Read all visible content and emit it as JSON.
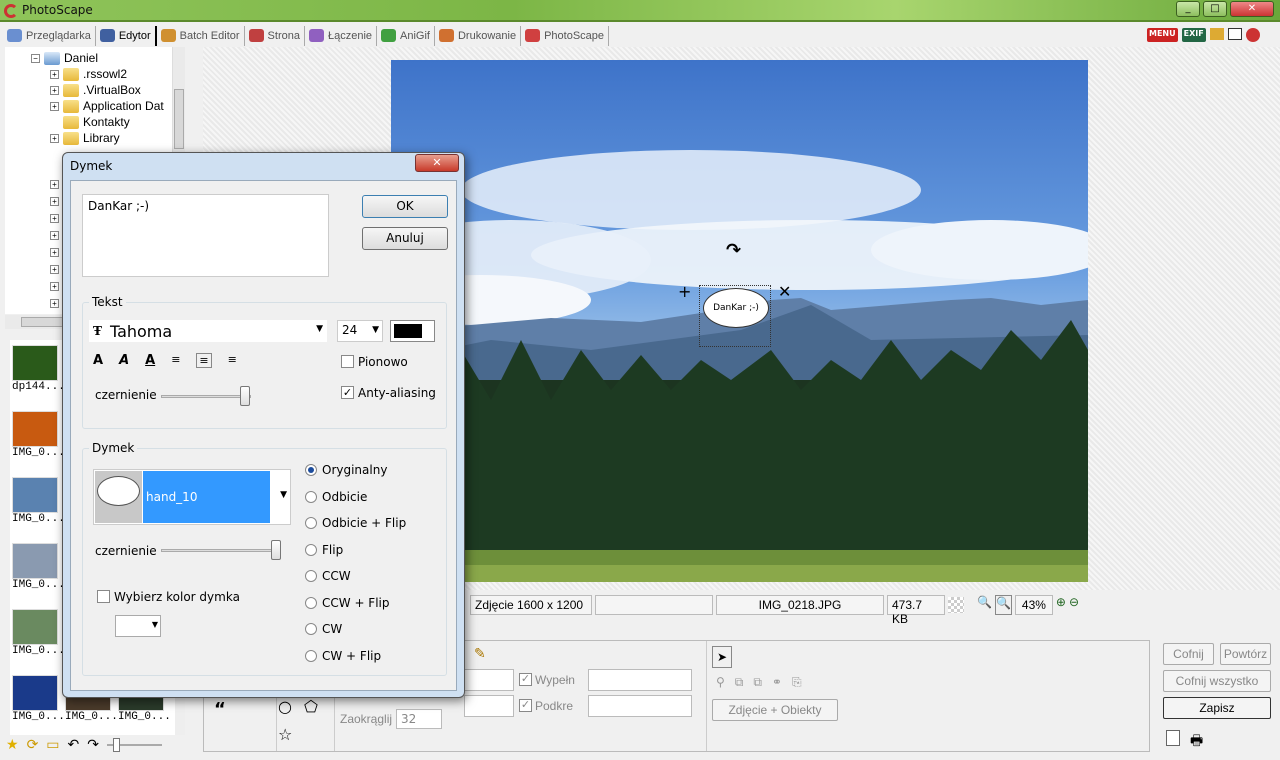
{
  "app": {
    "title": "PhotoScape"
  },
  "tabs": [
    {
      "label": "Przeglądarka",
      "color": "#6a8fd0"
    },
    {
      "label": "Edytor",
      "color": "#4060a0"
    },
    {
      "label": "Batch Editor",
      "color": "#d09030"
    },
    {
      "label": "Strona",
      "color": "#c04040"
    },
    {
      "label": "Łączenie",
      "color": "#9060c0"
    },
    {
      "label": "AniGif",
      "color": "#40a040"
    },
    {
      "label": "Drukowanie",
      "color": "#d07030"
    },
    {
      "label": "PhotoScape",
      "color": "#d04040"
    }
  ],
  "toolbar_right": [
    "MENU",
    "EXIF"
  ],
  "tree": {
    "root": "Daniel",
    "items": [
      ".rssowl2",
      ".VirtualBox",
      "Application Dat",
      "Kontakty",
      "Library"
    ]
  },
  "thumbnails": [
    "dp144...",
    "IMG_0...",
    "IMG_0...",
    "IMG_0...",
    "IMG_0...",
    "IMG_0...",
    "IMG_0...",
    "IMG_0..."
  ],
  "bubble": {
    "text": "DanKar ;-)"
  },
  "status": {
    "dimensions": "Zdjęcie 1600 x 1200",
    "filename": "IMG_0218.JPG",
    "filesize": "473.7 KB",
    "zoom": "43%"
  },
  "bottom": {
    "fill_label": "Wypełn",
    "border_label": "Podkre",
    "round_label": "Zaokrąglij",
    "round_value": "32",
    "photo_objects": "Zdjęcie + Obiekty"
  },
  "right_buttons": {
    "undo": "Cofnij",
    "redo": "Powtórz",
    "undo_all": "Cofnij wszystko",
    "save": "Zapisz"
  },
  "dialog": {
    "title": "Dymek",
    "text_value": "DanKar ;-)",
    "ok": "OK",
    "cancel": "Anuluj",
    "text_group": "Tekst",
    "font": "Tahoma",
    "size": "24",
    "text_color": "#000000",
    "vertical": "Pionowo",
    "vertical_checked": false,
    "antialias": "Anty-aliasing",
    "antialias_checked": true,
    "darkness_label": "czernienie",
    "text_darkness": 100,
    "bubble_group": "Dymek",
    "bubble_style": "hand_10",
    "bubble_darkness": 100,
    "choose_color": "Wybierz kolor dymka",
    "choose_color_checked": false,
    "orientations": [
      "Oryginalny",
      "Odbicie",
      "Odbicie + Flip",
      "Flip",
      "CCW",
      "CCW + Flip",
      "CW",
      "CW + Flip"
    ],
    "selected_orientation": "Oryginalny"
  }
}
